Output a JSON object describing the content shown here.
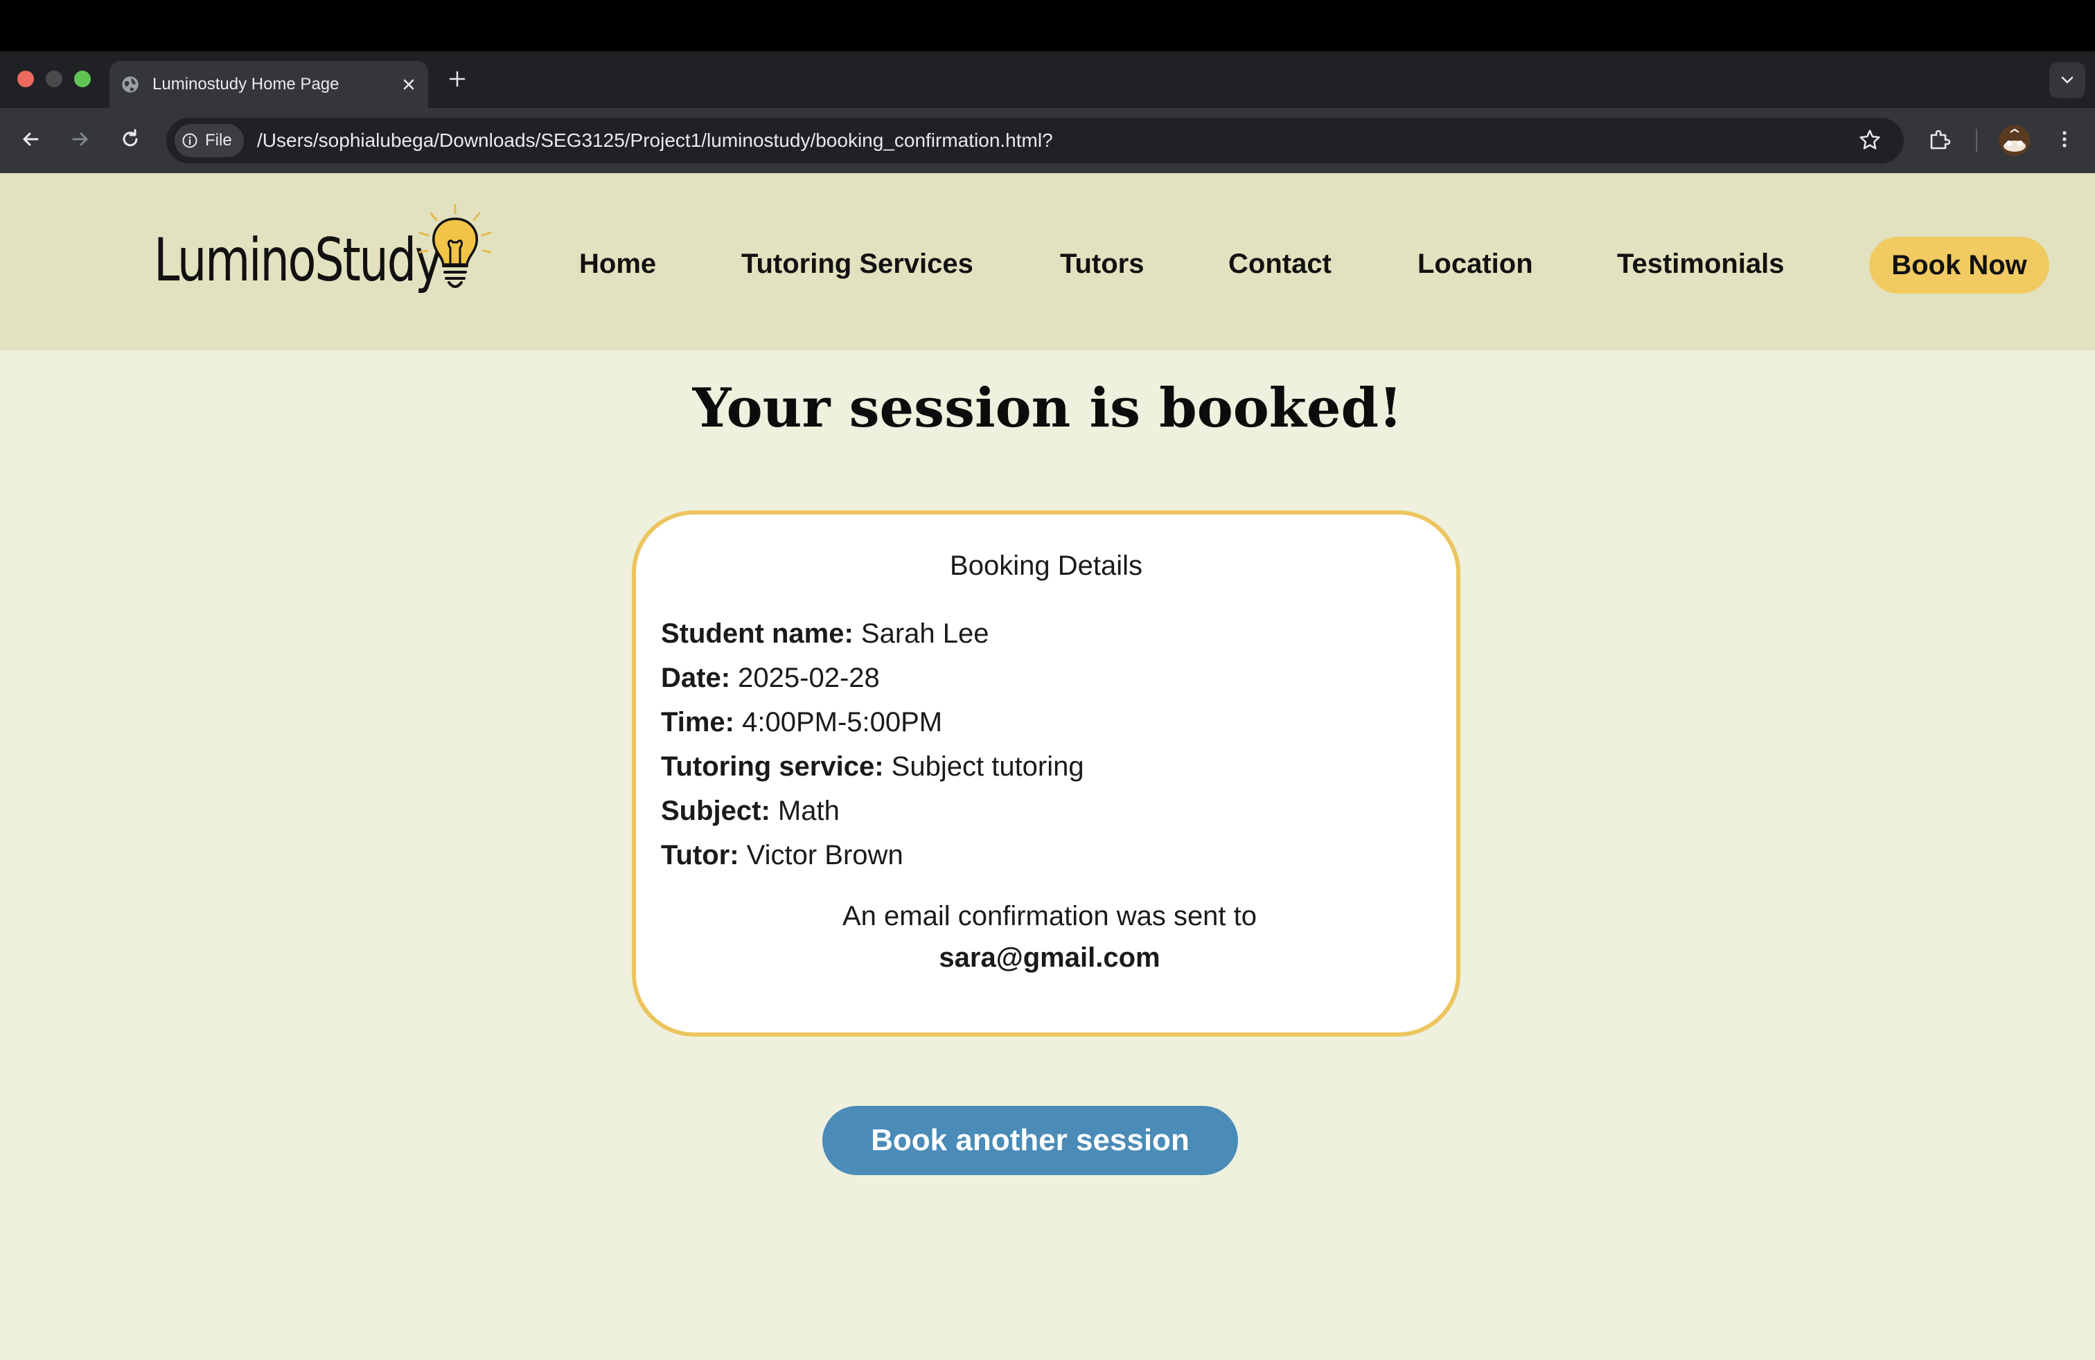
{
  "browser": {
    "tab_title": "Luminostudy Home Page",
    "file_chip_label": "File",
    "url": "/Users/sophialubega/Downloads/SEG3125/Project1/luminostudy/booking_confirmation.html?"
  },
  "header": {
    "logo_text": "LuminoStudy",
    "nav": [
      "Home",
      "Tutoring Services",
      "Tutors",
      "Contact",
      "Location",
      "Testimonials"
    ],
    "cta_label": "Book Now"
  },
  "main": {
    "title": "Your session is booked!",
    "card": {
      "heading": "Booking Details",
      "details": [
        {
          "label": "Student name:",
          "value": "Sarah Lee"
        },
        {
          "label": "Date:",
          "value": "2025-02-28"
        },
        {
          "label": "Time:",
          "value": "4:00PM-5:00PM"
        },
        {
          "label": "Tutoring service:",
          "value": "Subject tutoring"
        },
        {
          "label": "Subject:",
          "value": "Math"
        },
        {
          "label": "Tutor:",
          "value": "Victor Brown"
        }
      ],
      "email_message": "An email confirmation was sent to",
      "email": "sara@gmail.com"
    },
    "book_another_label": "Book another session"
  },
  "colors": {
    "header_bg": "#e2e2c0",
    "page_bg": "#eff0dd",
    "accent_yellow": "#f1cb62",
    "button_blue": "#4a8bb8",
    "card_border": "#ecc55f"
  },
  "icons": [
    "globe-icon",
    "close-icon",
    "plus-icon",
    "chevron-down-icon",
    "back-arrow-icon",
    "forward-arrow-icon",
    "reload-icon",
    "info-icon",
    "star-icon",
    "extensions-icon",
    "more-vert-icon",
    "lightbulb-icon"
  ]
}
